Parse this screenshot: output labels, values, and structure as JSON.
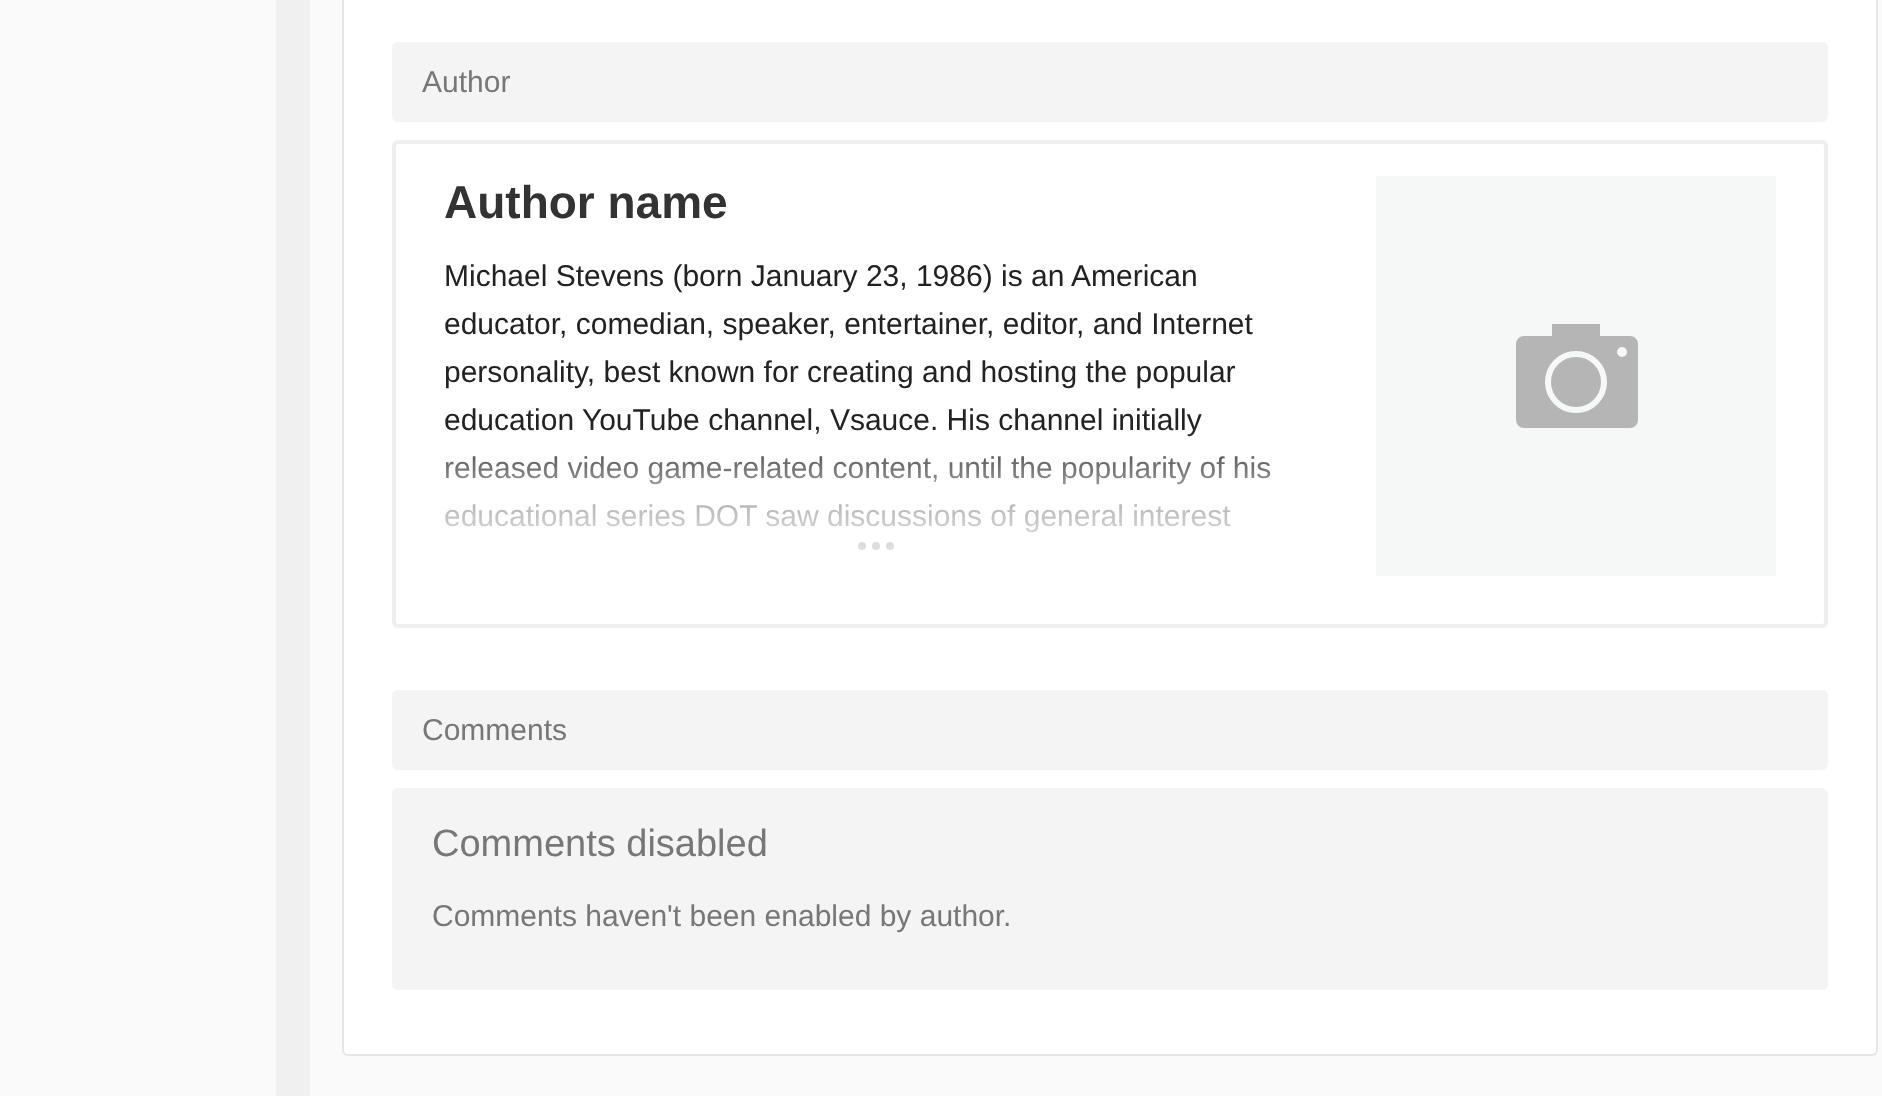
{
  "author": {
    "header": "Author",
    "name": "Author name",
    "bio": "Michael Stevens (born January 23, 1986) is an American educator, comedian, speaker, entertainer, editor, and Internet personality, best known for creating and hosting the popular education YouTube channel, Vsauce. His channel initially released video game-related content, until the popularity of his educational series DOT saw discussions of general interest",
    "photo": {
      "kind": "placeholder"
    }
  },
  "comments": {
    "header": "Comments",
    "title": "Comments disabled",
    "message": "Comments haven't been enabled by author."
  }
}
